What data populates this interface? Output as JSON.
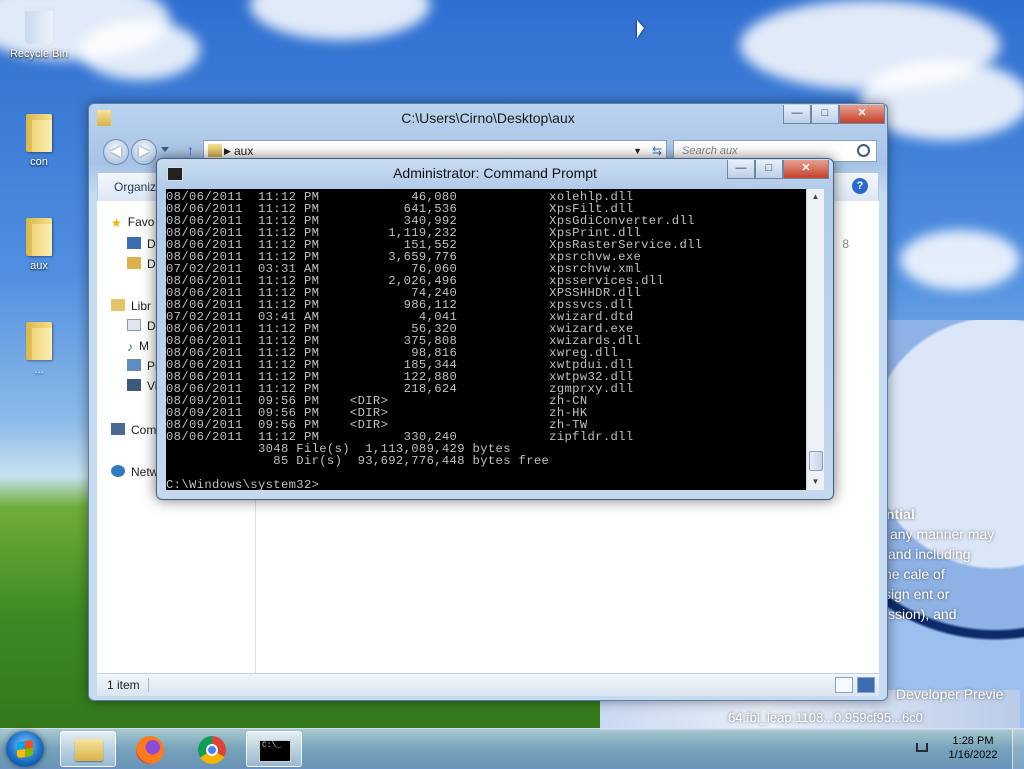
{
  "desktop": {
    "icons": [
      {
        "label": "Recycle Bin"
      },
      {
        "label": "con"
      },
      {
        "label": "aux"
      },
      {
        "label": "..."
      }
    ],
    "wallpaper_text": {
      "line1": "ntial",
      "line2": "any manner may",
      "line3": "and including",
      "line4": "he cale of",
      "line5": "sign ent or",
      "line6": "ssion), and",
      "line7": "Developer Previe",
      "line8": "64.fbl_leap.1108...0.959cf95...6c0"
    }
  },
  "explorer": {
    "title": "C:\\Users\\Cirno\\Desktop\\aux",
    "back_glyph": "◀",
    "forward_glyph": "▶",
    "address": "aux",
    "search_placeholder": "Search aux",
    "toolbar": {
      "organize": "Organiz"
    },
    "nav": {
      "favorites": "Favo",
      "item1": "De",
      "item2": "Do",
      "libraries": "Libr",
      "lib1": "Do",
      "lib2": "M",
      "lib3": "Pi",
      "lib4": "Vi",
      "computer": "Com",
      "network": "Netw"
    },
    "peek_number": "8",
    "status": {
      "items": "1 item"
    },
    "caption": {
      "min": "—",
      "max": "□",
      "close": "✕"
    }
  },
  "cmd": {
    "title": "Administrator: Command Prompt",
    "caption": {
      "min": "—",
      "max": "□",
      "close": "✕"
    },
    "lines": [
      "08/06/2011  11:12 PM            46,080            xolehlp.dll",
      "08/06/2011  11:12 PM           641,536            XpsFilt.dll",
      "08/06/2011  11:12 PM           340,992            XpsGdiConverter.dll",
      "08/06/2011  11:12 PM         1,119,232            XpsPrint.dll",
      "08/06/2011  11:12 PM           151,552            XpsRasterService.dll",
      "08/06/2011  11:12 PM         3,659,776            xpsrchvw.exe",
      "07/02/2011  03:31 AM            76,060            xpsrchvw.xml",
      "08/06/2011  11:12 PM         2,026,496            xpsservices.dll",
      "08/06/2011  11:12 PM            74,240            XPSSHHDR.dll",
      "08/06/2011  11:12 PM           986,112            xpssvcs.dll",
      "07/02/2011  03:41 AM             4,041            xwizard.dtd",
      "08/06/2011  11:12 PM            56,320            xwizard.exe",
      "08/06/2011  11:12 PM           375,808            xwizards.dll",
      "08/06/2011  11:12 PM            98,816            xwreg.dll",
      "08/06/2011  11:12 PM           185,344            xwtpdui.dll",
      "08/06/2011  11:12 PM           122,880            xwtpw32.dll",
      "08/06/2011  11:12 PM           218,624            zgmprxy.dll",
      "08/09/2011  09:56 PM    <DIR>                     zh-CN",
      "08/09/2011  09:56 PM    <DIR>                     zh-HK",
      "08/09/2011  09:56 PM    <DIR>                     zh-TW",
      "08/06/2011  11:12 PM           330,240            zipfldr.dll",
      "            3048 File(s)  1,113,089,429 bytes",
      "              85 Dir(s)  93,692,776,448 bytes free",
      "",
      "C:\\Windows\\system32>"
    ],
    "scroll_up": "▲",
    "scroll_down": "▼"
  },
  "taskbar": {
    "cmd_thumb": "C:\\_",
    "clock_time": "1:28 PM",
    "clock_date": "1/16/2022"
  }
}
